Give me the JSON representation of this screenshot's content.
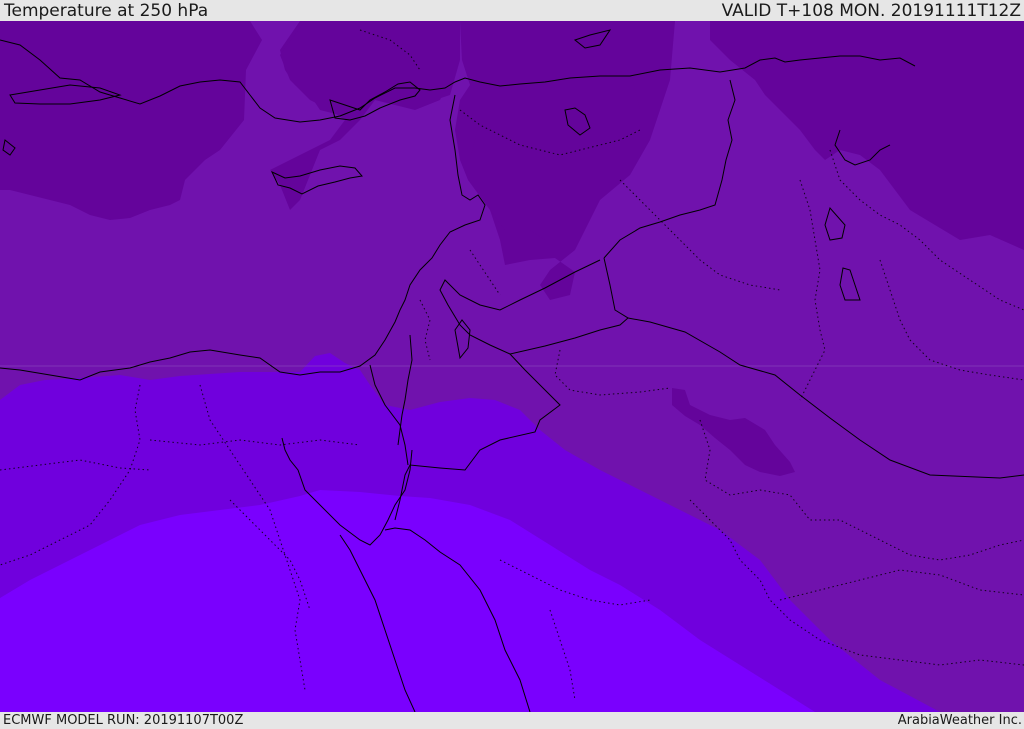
{
  "header": {
    "title": "Temperature at 250 hPa",
    "valid": "VALID T+108 MON. 20191111T12Z"
  },
  "footer": {
    "model_run": "ECMWF MODEL RUN: 20191107T00Z",
    "credit": "ArabiaWeather Inc."
  },
  "map": {
    "field": "temperature",
    "level": "250 hPa",
    "colors": {
      "coldest": "#64049b",
      "cold": "#7012ad",
      "mid": "#7000dd",
      "warm": "#7a00fe",
      "lines": "#000000"
    }
  }
}
